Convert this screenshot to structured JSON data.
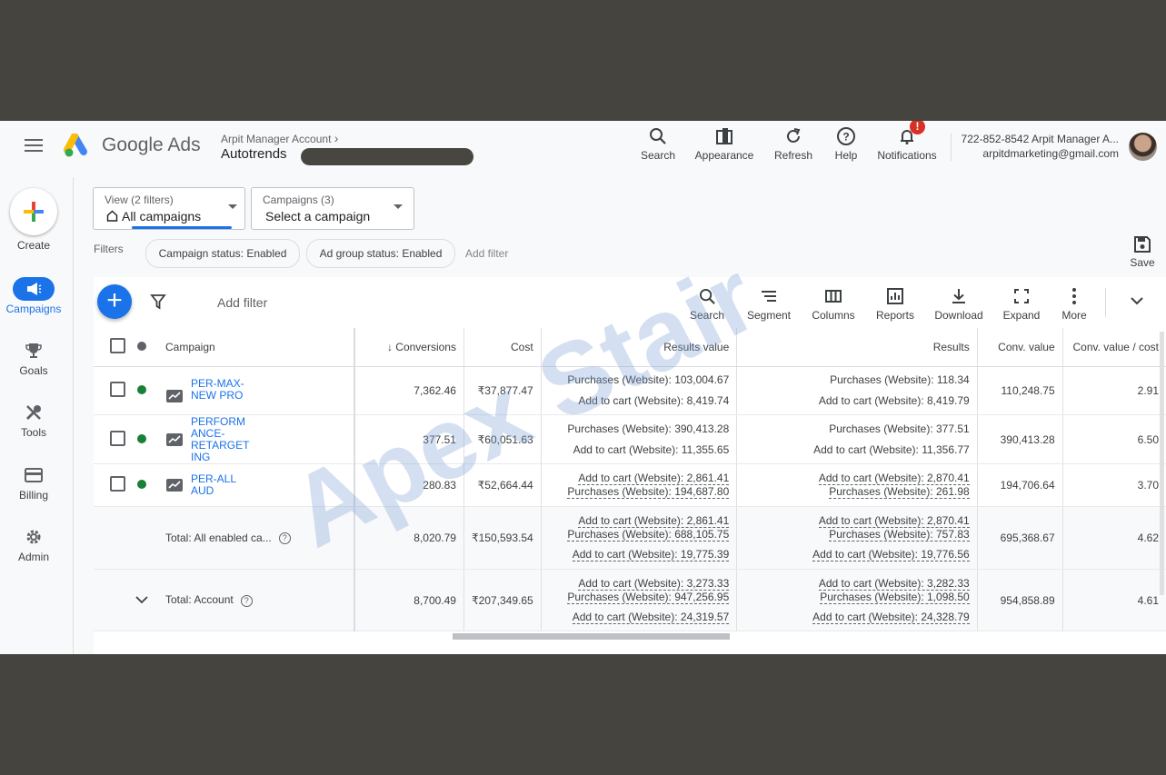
{
  "header": {
    "brand": "Google Ads",
    "manager_account": "Arpit Manager Account",
    "account_name": "Autotrends",
    "tools": [
      {
        "label": "Search",
        "icon": "search-icon"
      },
      {
        "label": "Appearance",
        "icon": "appearance-icon"
      },
      {
        "label": "Refresh",
        "icon": "refresh-icon"
      },
      {
        "label": "Help",
        "icon": "help-icon"
      },
      {
        "label": "Notifications",
        "icon": "bell-icon"
      }
    ],
    "notification_badge": "!",
    "account_line1": "722-852-8542 Arpit Manager A...",
    "account_line2": "arpitdmarketing@gmail.com"
  },
  "nav": {
    "create": "Create",
    "items": [
      {
        "label": "Campaigns",
        "icon": "megaphone-icon",
        "active": true
      },
      {
        "label": "Goals",
        "icon": "trophy-icon"
      },
      {
        "label": "Tools",
        "icon": "tools-icon"
      },
      {
        "label": "Billing",
        "icon": "credit-card-icon"
      },
      {
        "label": "Admin",
        "icon": "gear-icon"
      }
    ]
  },
  "view": {
    "small": "View (2 filters)",
    "value": "All campaigns"
  },
  "campaign_select": {
    "small": "Campaigns (3)",
    "value": "Select a campaign"
  },
  "filters": {
    "label": "Filters",
    "chips": [
      "Campaign status: Enabled",
      "Ad group status: Enabled"
    ],
    "add": "Add filter"
  },
  "save_label": "Save",
  "toolbar": {
    "add_filter": "Add filter",
    "tools": [
      "Search",
      "Segment",
      "Columns",
      "Reports",
      "Download",
      "Expand",
      "More"
    ]
  },
  "table": {
    "headers": {
      "campaign": "Campaign",
      "conversions": "Conversions",
      "cost": "Cost",
      "results_value": "Results value",
      "results": "Results",
      "conv_value": "Conv. value",
      "conv_value_cost": "Conv. value / cost"
    },
    "rows": [
      {
        "name": [
          "PER-MAX-",
          "NEW PRO"
        ],
        "conversions": "7,362.46",
        "cost": "₹37,877.47",
        "results_value": [
          "Purchases (Website): 103,004.67",
          "Add to cart (Website): 8,419.74"
        ],
        "results": [
          "Purchases (Website): 118.34",
          "Add to cart (Website): 8,419.79"
        ],
        "conv_value": "110,248.75",
        "conv_value_cost": "2.91"
      },
      {
        "name": [
          "PERFORM",
          "ANCE-",
          "RETARGET",
          "ING"
        ],
        "conversions": "377.51",
        "cost": "₹60,051.63",
        "results_value": [
          "Purchases (Website): 390,413.28",
          "Add to cart (Website): 11,355.65"
        ],
        "results": [
          "Purchases (Website): 377.51",
          "Add to cart (Website): 11,356.77"
        ],
        "conv_value": "390,413.28",
        "conv_value_cost": "6.50"
      },
      {
        "name": [
          "PER-ALL",
          "AUD"
        ],
        "conversions": "280.83",
        "cost": "₹52,664.44",
        "results_value": [
          "Add to cart (Website): 2,861.41",
          "Purchases (Website): 194,687.80"
        ],
        "results": [
          "Add to cart (Website): 2,870.41",
          "Purchases (Website): 261.98"
        ],
        "conv_value": "194,706.64",
        "conv_value_cost": "3.70"
      }
    ],
    "totals": [
      {
        "label": "Total: All enabled ca...",
        "conversions": "8,020.79",
        "cost": "₹150,593.54",
        "results_value": [
          "Add to cart (Website): 2,861.41",
          "Purchases (Website): 688,105.75",
          "Add to cart (Website): 19,775.39"
        ],
        "results": [
          "Add to cart (Website): 2,870.41",
          "Purchases (Website): 757.83",
          "Add to cart (Website): 19,776.56"
        ],
        "conv_value": "695,368.67",
        "conv_value_cost": "4.62"
      },
      {
        "label": "Total: Account",
        "conversions": "8,700.49",
        "cost": "₹207,349.65",
        "results_value": [
          "Add to cart (Website): 3,273.33",
          "Purchases (Website): 947,256.95",
          "Add to cart (Website): 24,319.57"
        ],
        "results": [
          "Add to cart (Website): 3,282.33",
          "Purchases (Website): 1,098.50",
          "Add to cart (Website): 24,328.79"
        ],
        "conv_value": "954,858.89",
        "conv_value_cost": "4.61"
      }
    ]
  },
  "watermark": "Apex Stair",
  "colors": {
    "accent": "#1a73e8",
    "enabled": "#188038",
    "alert": "#d93025"
  }
}
